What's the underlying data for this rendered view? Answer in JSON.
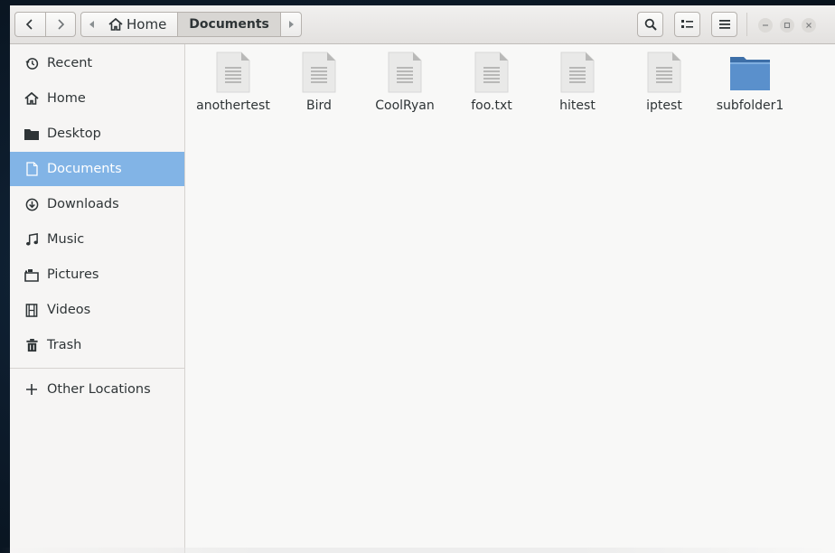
{
  "window": {
    "title": "Documents"
  },
  "toolbar": {
    "back_label": "<",
    "forward_label": ">",
    "path": [
      {
        "label": "Home",
        "icon": "home-icon"
      },
      {
        "label": "Documents",
        "active": true
      }
    ],
    "search_icon": "search-icon",
    "view_toggle_icon": "list-view-icon",
    "menu_icon": "hamburger-menu-icon"
  },
  "sidebar": {
    "items": [
      {
        "label": "Recent",
        "icon": "clock-icon"
      },
      {
        "label": "Home",
        "icon": "home-icon"
      },
      {
        "label": "Desktop",
        "icon": "folder-icon"
      },
      {
        "label": "Documents",
        "icon": "document-icon",
        "active": true
      },
      {
        "label": "Downloads",
        "icon": "download-icon"
      },
      {
        "label": "Music",
        "icon": "music-icon"
      },
      {
        "label": "Pictures",
        "icon": "camera-icon"
      },
      {
        "label": "Videos",
        "icon": "film-icon"
      },
      {
        "label": "Trash",
        "icon": "trash-icon"
      },
      {
        "label": "Other Locations",
        "icon": "plus-icon"
      }
    ]
  },
  "files": [
    {
      "name": "anothertest",
      "type": "document"
    },
    {
      "name": "Bird",
      "type": "document"
    },
    {
      "name": "CoolRyan",
      "type": "document"
    },
    {
      "name": "foo.txt",
      "type": "document"
    },
    {
      "name": "hitest",
      "type": "document"
    },
    {
      "name": "iptest",
      "type": "document"
    },
    {
      "name": "subfolder1",
      "type": "folder"
    }
  ],
  "colors": {
    "accent": "#82b4e6",
    "folder": "#4f85c3"
  }
}
